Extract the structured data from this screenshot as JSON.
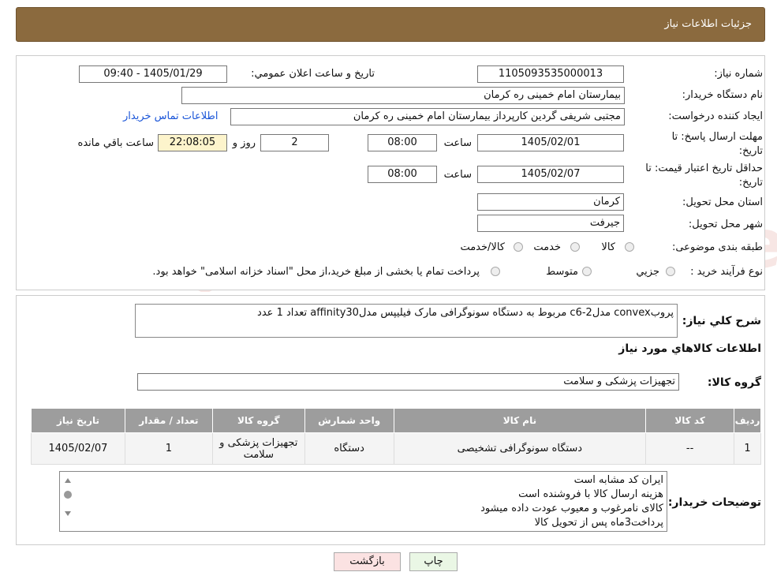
{
  "header": {
    "title": "جزئیات اطلاعات نیاز"
  },
  "form": {
    "need_number_label": "شماره نیاز:",
    "need_number": "1105093535000013",
    "announce_label": "تاریخ و ساعت اعلان عمومي:",
    "announce_value": "1405/01/29 - 09:40",
    "buyer_label": "نام دستگاه خریدار:",
    "buyer_value": "بیمارستان امام خمینی  ره  کرمان",
    "creator_label": "ایجاد کننده درخواست:",
    "creator_value": "مجتبی شریفی گردین کارپرداز بیمارستان امام خمینی  ره  کرمان",
    "contact_link": "اطلاعات تماس خریدار",
    "deadline_label_1": "مهلت ارسال پاسخ: تا",
    "deadline_label_2": "تاریخ:",
    "deadline_date": "1405/02/01",
    "time_label": "ساعت",
    "deadline_time": "08:00",
    "days_value": "2",
    "days_label": "روز و",
    "remaining_value": "22:08:05",
    "remaining_label": "ساعت باقي مانده",
    "validity_label_1": "حداقل تاریخ اعتبار قیمت: تا",
    "validity_label_2": "تاریخ:",
    "validity_date": "1405/02/07",
    "validity_time": "08:00",
    "province_label": "استان محل تحویل:",
    "province_value": "کرمان",
    "city_label": "شهر محل تحویل:",
    "city_value": "جیرفت",
    "category_label": "طبقه بندی موضوعی:",
    "category_options": [
      "کالا",
      "خدمت",
      "کالا/خدمت"
    ],
    "process_label": "نوع فرآیند خرید :",
    "process_options": [
      "جزیي",
      "متوسط"
    ],
    "process_note": "پرداخت تمام یا بخشی از مبلغ خرید،از محل \"اسناد خزانه اسلامی\" خواهد بود."
  },
  "description": {
    "label": "شرح کلي نیاز:",
    "value": "پروبconvex  مدلc6-2 مربوط به دستگاه سونوگرافی مارک فیلیپس مدلaffinity30  تعداد 1 عدد"
  },
  "goods": {
    "section_title": "اطلاعات کالاهاي مورد نیاز",
    "group_label": "گروه کالا:",
    "group_value": "تجهیزات پزشکی و سلامت",
    "columns": [
      "ردیف",
      "کد کالا",
      "نام کالا",
      "واحد شمارش",
      "گروه کالا",
      "تعداد / مقدار",
      "تاریخ نیاز"
    ],
    "rows": [
      [
        "1",
        "--",
        "دستگاه سونوگرافی تشخیصی",
        "دستگاه",
        "تجهیزات پزشکی و سلامت",
        "1",
        "1405/02/07"
      ]
    ]
  },
  "buyer_notes": {
    "label": "توضیحات خریدار:",
    "lines": [
      "ایران کد مشابه است",
      "هزینه ارسال کالا با فروشنده است",
      "کالای نامرغوب و معیوب عودت داده میشود",
      "پرداخت3ماه پس از تحویل کالا"
    ]
  },
  "buttons": {
    "print": "چاپ",
    "back": "بازگشت"
  },
  "watermark": {
    "text": "AriaTender.neT"
  },
  "colors": {
    "header_bg": "#8b6a3e",
    "table_header": "#9d9d9d",
    "link": "#1a55d8"
  }
}
